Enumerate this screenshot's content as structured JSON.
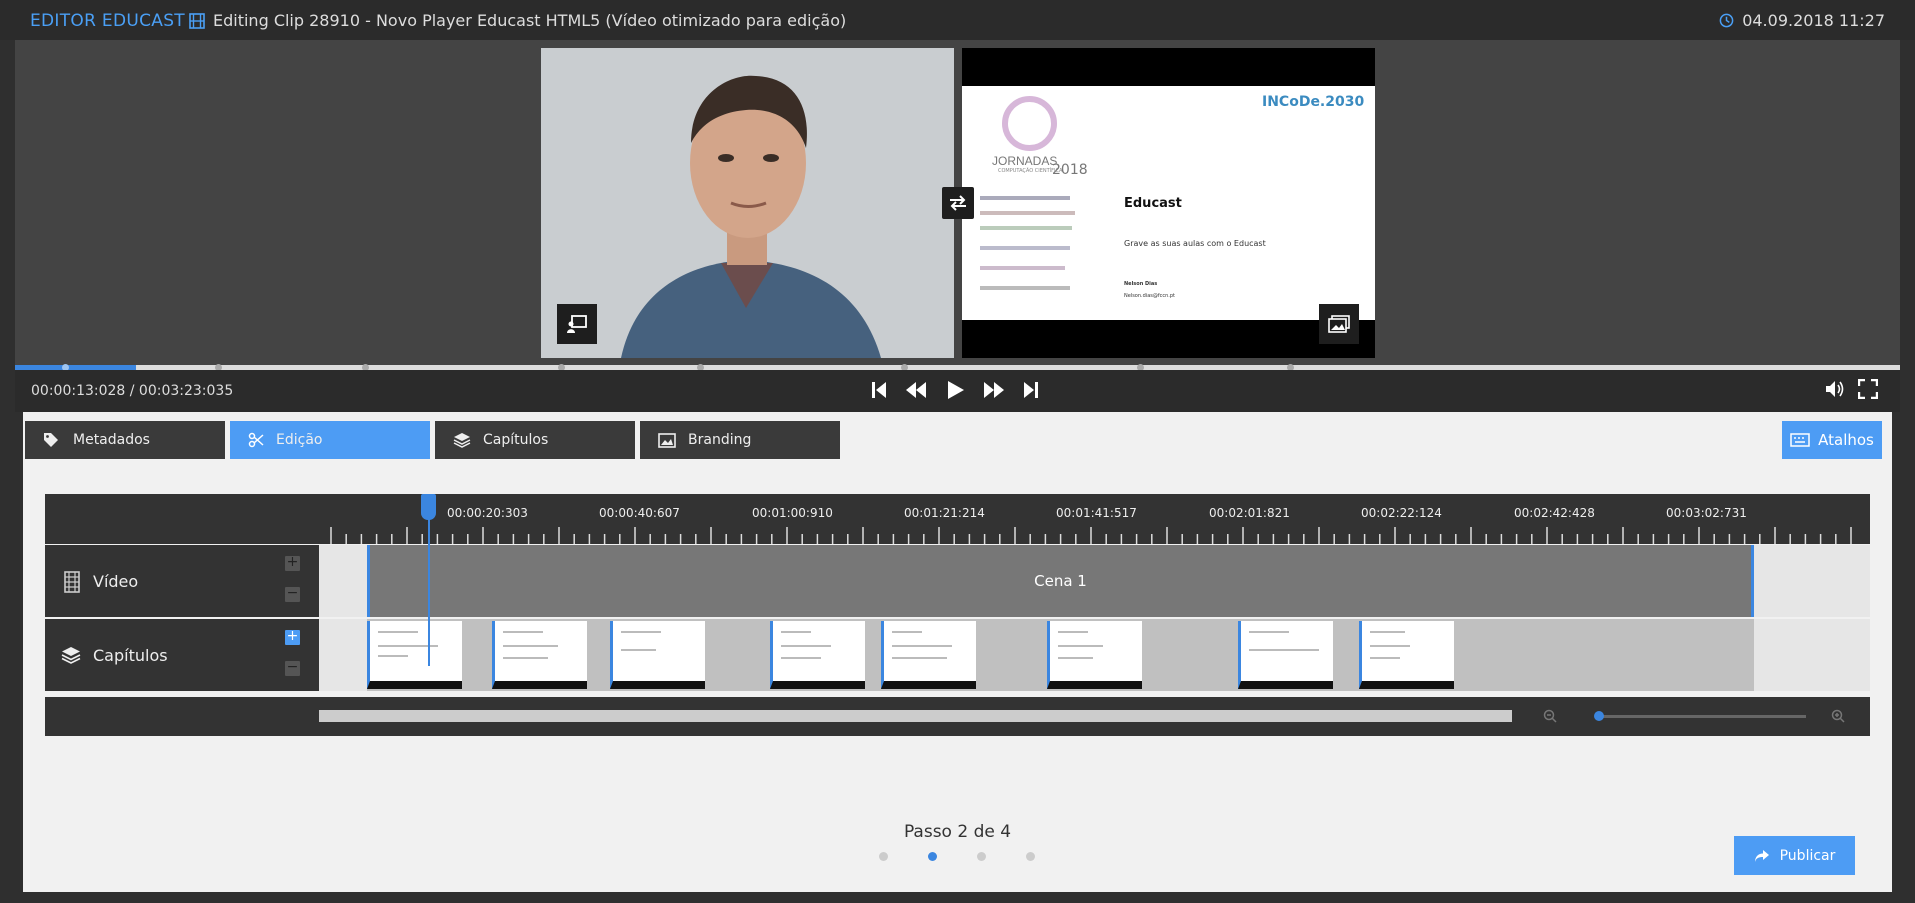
{
  "app": {
    "brand": "EDITOR EDUCAST",
    "clip_title": "Editing Clip 28910 - Novo Player Educast HTML5  (Vídeo otimizado para edição)",
    "datetime": "04.09.2018 11:27"
  },
  "player": {
    "time_display": "00:00:13:028 / 00:03:23:035",
    "progress_fraction": 0.064,
    "slide": {
      "logo_line1": "JORNADAS",
      "logo_line2": "COMPUTAÇÃO CIENTÍFICA",
      "logo_year": "2018",
      "incode": "INCoDe.2030",
      "heading": "Educast",
      "subtitle": "Grave as suas aulas com o Educast",
      "author": "Nelson Dias",
      "email": "Nelson.dias@fccn.pt"
    }
  },
  "tabs": [
    {
      "label": "Metadados",
      "icon": "tags-icon"
    },
    {
      "label": "Edição",
      "icon": "scissors-icon"
    },
    {
      "label": "Capítulos",
      "icon": "layers-icon"
    },
    {
      "label": "Branding",
      "icon": "image-icon"
    }
  ],
  "shortcuts_label": "Atalhos",
  "timeline": {
    "tick_labels": [
      "00:00:20:303",
      "00:00:40:607",
      "00:01:00:910",
      "00:01:21:214",
      "00:01:41:517",
      "00:02:01:821",
      "00:02:22:124",
      "00:02:42:428",
      "00:03:02:731"
    ],
    "video_track_label": "Vídeo",
    "chapters_track_label": "Capítulos",
    "scene_label": "Cena 1",
    "chapter_count": 8
  },
  "step": {
    "text": "Passo 2 de 4",
    "current": 2,
    "total": 4
  },
  "publish_label": "Publicar",
  "colors": {
    "accent": "#4d9cf4",
    "brand": "#4a9ff5",
    "dark": "#333333"
  }
}
